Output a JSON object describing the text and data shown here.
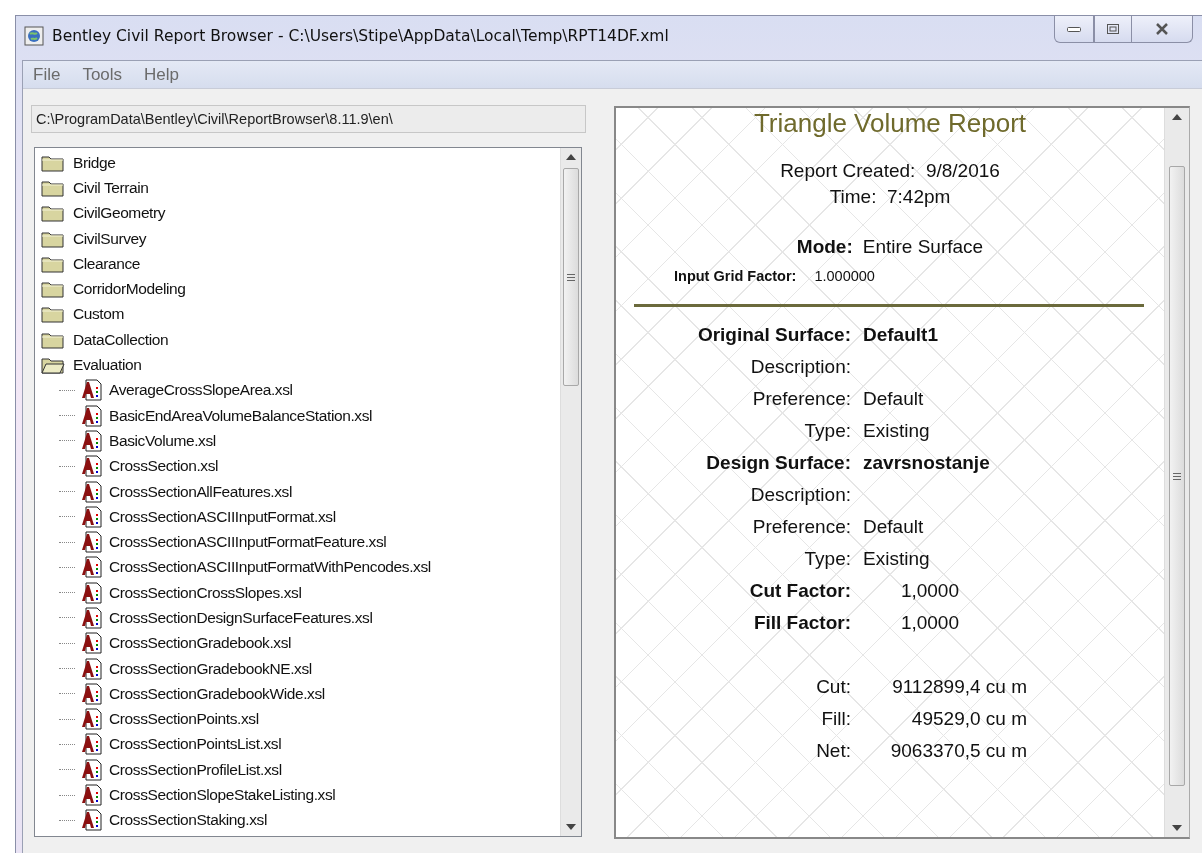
{
  "window": {
    "title": "Bentley Civil Report Browser - C:\\Users\\Stipe\\AppData\\Local\\Temp\\RPT14DF.xml"
  },
  "menu": [
    "File",
    "Tools",
    "Help"
  ],
  "path_field": {
    "value": "C:\\ProgramData\\Bentley\\Civil\\ReportBrowser\\8.11.9\\en\\"
  },
  "tree": [
    {
      "label": "Bridge",
      "kind": "folder",
      "expanded": false
    },
    {
      "label": "Civil Terrain",
      "kind": "folder",
      "expanded": false
    },
    {
      "label": "CivilGeometry",
      "kind": "folder",
      "expanded": false
    },
    {
      "label": "CivilSurvey",
      "kind": "folder",
      "expanded": false
    },
    {
      "label": "Clearance",
      "kind": "folder",
      "expanded": false
    },
    {
      "label": "CorridorModeling",
      "kind": "folder",
      "expanded": false
    },
    {
      "label": "Custom",
      "kind": "folder",
      "expanded": false
    },
    {
      "label": "DataCollection",
      "kind": "folder",
      "expanded": false
    },
    {
      "label": "Evaluation",
      "kind": "folder",
      "expanded": true,
      "children": [
        {
          "label": "AverageCrossSlopeArea.xsl",
          "kind": "file"
        },
        {
          "label": "BasicEndAreaVolumeBalanceStation.xsl",
          "kind": "file"
        },
        {
          "label": "BasicVolume.xsl",
          "kind": "file"
        },
        {
          "label": "CrossSection.xsl",
          "kind": "file"
        },
        {
          "label": "CrossSectionAllFeatures.xsl",
          "kind": "file"
        },
        {
          "label": "CrossSectionASCIIInputFormat.xsl",
          "kind": "file"
        },
        {
          "label": "CrossSectionASCIIInputFormatFeature.xsl",
          "kind": "file"
        },
        {
          "label": "CrossSectionASCIIInputFormatWithPencodes.xsl",
          "kind": "file"
        },
        {
          "label": "CrossSectionCrossSlopes.xsl",
          "kind": "file"
        },
        {
          "label": "CrossSectionDesignSurfaceFeatures.xsl",
          "kind": "file"
        },
        {
          "label": "CrossSectionGradebook.xsl",
          "kind": "file"
        },
        {
          "label": "CrossSectionGradebookNE.xsl",
          "kind": "file"
        },
        {
          "label": "CrossSectionGradebookWide.xsl",
          "kind": "file"
        },
        {
          "label": "CrossSectionPoints.xsl",
          "kind": "file"
        },
        {
          "label": "CrossSectionPointsList.xsl",
          "kind": "file"
        },
        {
          "label": "CrossSectionProfileList.xsl",
          "kind": "file"
        },
        {
          "label": "CrossSectionSlopeStakeListing.xsl",
          "kind": "file"
        },
        {
          "label": "CrossSectionStaking.xsl",
          "kind": "file"
        }
      ]
    }
  ],
  "report": {
    "title": "Triangle Volume Report",
    "created": [
      {
        "label": "Report Created:",
        "value": "9/8/2016"
      },
      {
        "label": "Time:",
        "value": "7:42pm"
      }
    ],
    "mode": {
      "label": "Mode:",
      "value": "Entire Surface"
    },
    "grid_factor": {
      "label": "Input Grid Factor:",
      "value": "1.000000"
    },
    "groups": [
      {
        "rows": [
          {
            "kind": "heading",
            "label": "Original Surface:",
            "value": "Default1"
          },
          {
            "kind": "field",
            "label": "Description:"
          },
          {
            "kind": "field",
            "label": "Preference:",
            "value": "Default"
          },
          {
            "kind": "field",
            "label": "Type:",
            "value": "Existing"
          },
          {
            "kind": "heading",
            "label": "Design Surface:",
            "value": "zavrsnostanje"
          },
          {
            "kind": "field",
            "label": "Description:"
          },
          {
            "kind": "field",
            "label": "Preference:",
            "value": "Default"
          },
          {
            "kind": "field",
            "label": "Type:",
            "value": "Existing"
          },
          {
            "kind": "factor",
            "label": "Cut Factor:",
            "value": "1,0000"
          },
          {
            "kind": "factor",
            "label": "Fill Factor:",
            "value": "1,0000"
          }
        ]
      },
      {
        "rows": [
          {
            "kind": "total",
            "label": "Cut:",
            "value": "9112899,4 cu m"
          },
          {
            "kind": "total",
            "label": "Fill:",
            "value": "49529,0 cu m"
          },
          {
            "kind": "total",
            "label": "Net:",
            "value": "9063370,5 cu m"
          }
        ]
      }
    ]
  }
}
